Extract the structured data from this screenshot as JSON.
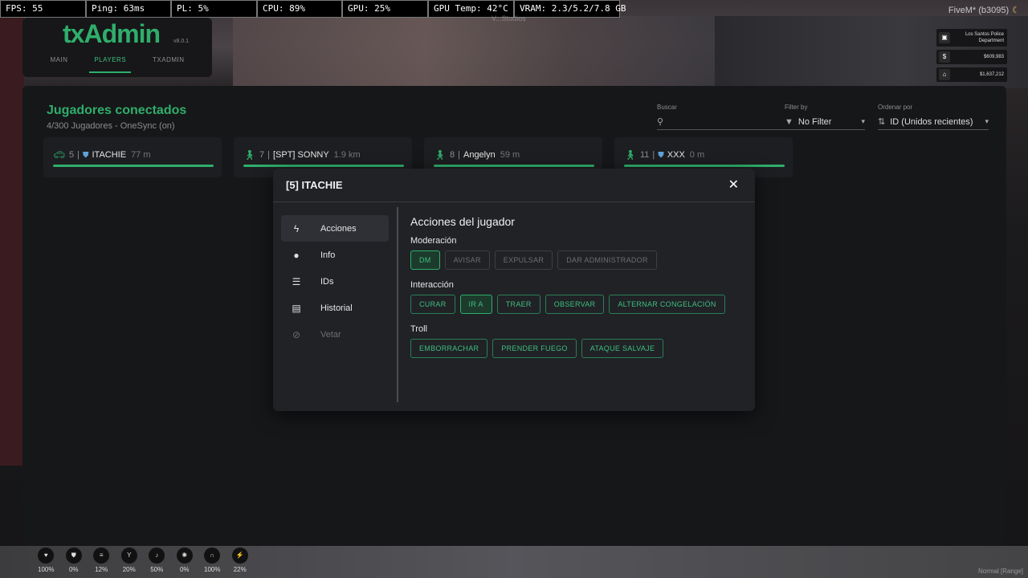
{
  "perf_bar": [
    "FPS: 55",
    "Ping: 63ms",
    "PL: 5%",
    "CPU: 89%",
    "GPU: 25%",
    "GPU Temp: 42°C",
    "VRAM: 2.3/5.2/7.8 GB"
  ],
  "server_tag": "FiveM* (b3095)",
  "watermark": "V...Studios",
  "hud_right": {
    "job": "Los Santos Police Department",
    "cash": "$609,983",
    "bank": "$1,637,212"
  },
  "txadmin": {
    "logo": "txAdmin",
    "version": "v8.0.1",
    "tabs": [
      "MAIN",
      "PLAYERS",
      "TXADMIN"
    ]
  },
  "players_panel": {
    "title": "Jugadores conectados",
    "subtitle": "4/300 Jugadores - OneSync (on)",
    "search": {
      "label": "Buscar",
      "value": ""
    },
    "filter": {
      "label": "Filter by",
      "value": "No Filter"
    },
    "order": {
      "label": "Ordenar por",
      "value": "ID (Unidos recientes)"
    },
    "players": [
      {
        "id": "5",
        "name": "ITACHIE",
        "dist": "77 m"
      },
      {
        "id": "7",
        "name": "[SPT] SONNY",
        "dist": "1.9 km"
      },
      {
        "id": "8",
        "name": "Angelyn",
        "dist": "59 m"
      },
      {
        "id": "11",
        "name": "XXX",
        "dist": "0 m"
      }
    ]
  },
  "modal": {
    "title": "[5] ITACHIE",
    "nav": [
      "Acciones",
      "Info",
      "IDs",
      "Historial",
      "Vetar"
    ],
    "content_title": "Acciones del jugador",
    "sections": {
      "moderation": {
        "label": "Moderación",
        "buttons": [
          "DM",
          "AVISAR",
          "EXPULSAR",
          "DAR ADMINISTRADOR"
        ]
      },
      "interaction": {
        "label": "Interacción",
        "buttons": [
          "CURAR",
          "IR A",
          "TRAER",
          "OBSERVAR",
          "ALTERNAR CONGELACIÓN"
        ]
      },
      "troll": {
        "label": "Troll",
        "buttons": [
          "EMBORRACHAR",
          "PRENDER FUEGO",
          "ATAQUE SALVAJE"
        ]
      }
    }
  },
  "hud_bottom": [
    "100%",
    "0%",
    "12%",
    "20%",
    "50%",
    "0%",
    "100%",
    "22%"
  ],
  "corner_note": "Normal [Range]",
  "colors": {
    "accent": "#2fae6b",
    "panel": "#161719",
    "modal": "#202226"
  }
}
